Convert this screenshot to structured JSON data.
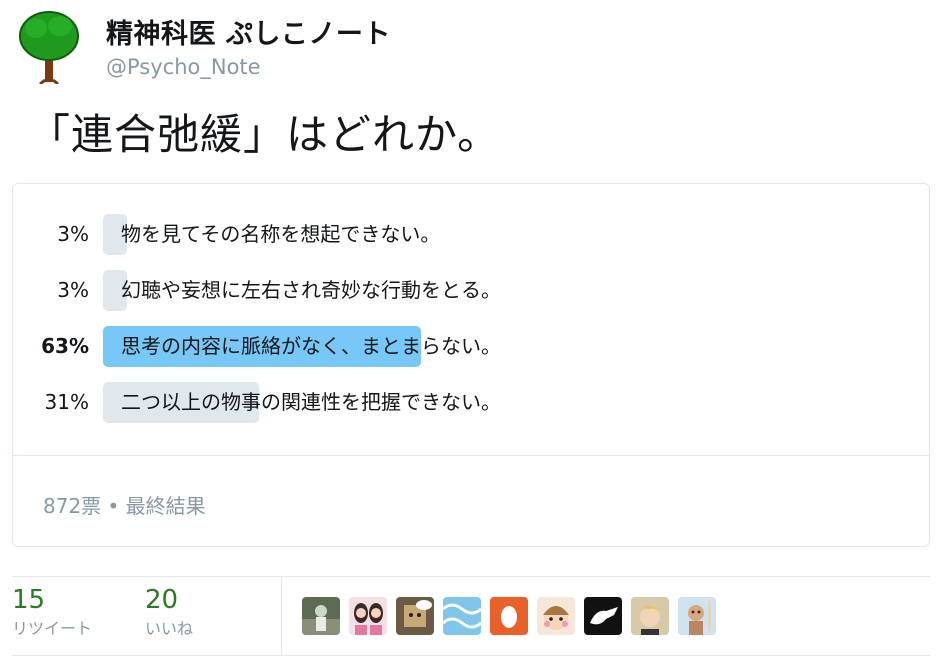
{
  "header": {
    "display_name": "精神科医 ぷしこノート",
    "handle": "@Psycho_Note",
    "avatar_icon": "tree-icon"
  },
  "tweet": {
    "text": "「連合弛緩」はどれか。"
  },
  "poll": {
    "choices": [
      {
        "percent_label": "3%",
        "percent": 3,
        "label": "物を見てその名称を想起できない。",
        "winner": false
      },
      {
        "percent_label": "3%",
        "percent": 3,
        "label": "幻聴や妄想に左右され奇妙な行動をとる。",
        "winner": false
      },
      {
        "percent_label": "63%",
        "percent": 63,
        "label": "思考の内容に脈絡がなく、まとまらない。",
        "winner": true
      },
      {
        "percent_label": "31%",
        "percent": 31,
        "label": "二つ以上の物事の関連性を把握できない。",
        "winner": false
      }
    ],
    "meta": "872票 • 最終結果",
    "colors": {
      "bar": "#e1e8ed",
      "winner_bar": "#77c7f7"
    }
  },
  "stats": {
    "retweets": {
      "count": "15",
      "label": "リツイート"
    },
    "likes": {
      "count": "20",
      "label": "いいね"
    }
  },
  "likers": [
    {
      "icon": "photo-landscape-avatar"
    },
    {
      "icon": "two-girls-avatar"
    },
    {
      "icon": "box-character-avatar"
    },
    {
      "icon": "blue-pattern-avatar"
    },
    {
      "icon": "egg-avatar"
    },
    {
      "icon": "cartoon-boy-avatar"
    },
    {
      "icon": "white-hand-avatar"
    },
    {
      "icon": "blond-person-avatar"
    },
    {
      "icon": "doll-avatar"
    }
  ]
}
